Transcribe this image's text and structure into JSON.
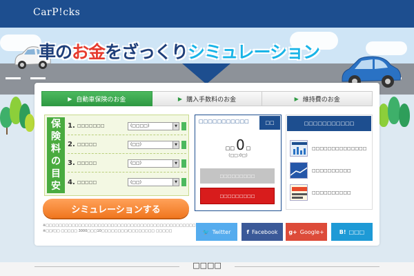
{
  "header": {
    "logo": "CarP!cks"
  },
  "hero": {
    "headline_a": "車の",
    "headline_b": "お金",
    "headline_c": "をざっくり",
    "headline_d": "シミュレーション"
  },
  "tabs": [
    {
      "label": "自動車保険のお金",
      "active": true
    },
    {
      "label": "購入手数料のお金",
      "active": false
    },
    {
      "label": "維持費のお金",
      "active": false
    }
  ],
  "form": {
    "vertical_label": [
      "保",
      "険",
      "料",
      "の",
      "目",
      "安"
    ],
    "rows": [
      {
        "num": "1.",
        "label": "□□□□□□□",
        "value": "(□□□□)"
      },
      {
        "num": "2.",
        "label": "□□□□□",
        "value": "(□□)"
      },
      {
        "num": "3.",
        "label": "□□□□□",
        "value": "(□□)"
      },
      {
        "num": "4.",
        "label": "□□□□□",
        "value": "(□□)"
      }
    ],
    "submit_label": "シミュレーションする",
    "note": "※□□□□□□□□□□□□□□□□□□□□□□□□□□□□□□□□□□□□□□□□□□□□□□□□□□□□□□□□□□ ※□□/□□ □□□□□ 3000□□□10□□□□□□□□/□□□□□□□□ □□□□□"
  },
  "result": {
    "title": "□□□□□□□□□□□",
    "badge": "□□",
    "prefix": "□□",
    "value": "0",
    "suffix": "□",
    "sub": "(□□:0□)",
    "gray_button": "□□□□□□□□□",
    "red_button": "□□□□□□□□□"
  },
  "side": {
    "heading": "□□□□□□□□□□□",
    "items": [
      {
        "text": "□□□□□□□□□□□□□□"
      },
      {
        "text": "□□□□□□□□□□"
      },
      {
        "text": "□□□□□□□□□□"
      }
    ]
  },
  "social": [
    {
      "label": "Twitter",
      "icon": "bird-icon",
      "glyph": "🐦",
      "color": "#55acee"
    },
    {
      "label": "Facebook",
      "icon": "facebook-icon",
      "glyph": "f",
      "color": "#3b5998"
    },
    {
      "label": "Google+",
      "icon": "google-plus-icon",
      "glyph": "g+",
      "color": "#dd4b39"
    },
    {
      "label": "□□□",
      "icon": "hatena-icon",
      "glyph": "B!",
      "color": "#1e9ad6"
    }
  ],
  "footer": {
    "section_title": "□□□□"
  },
  "colors": {
    "brand": "#1d4e8f",
    "accent_green": "#2f9a43",
    "accent_orange": "#f0761f",
    "danger": "#d81c1c"
  }
}
